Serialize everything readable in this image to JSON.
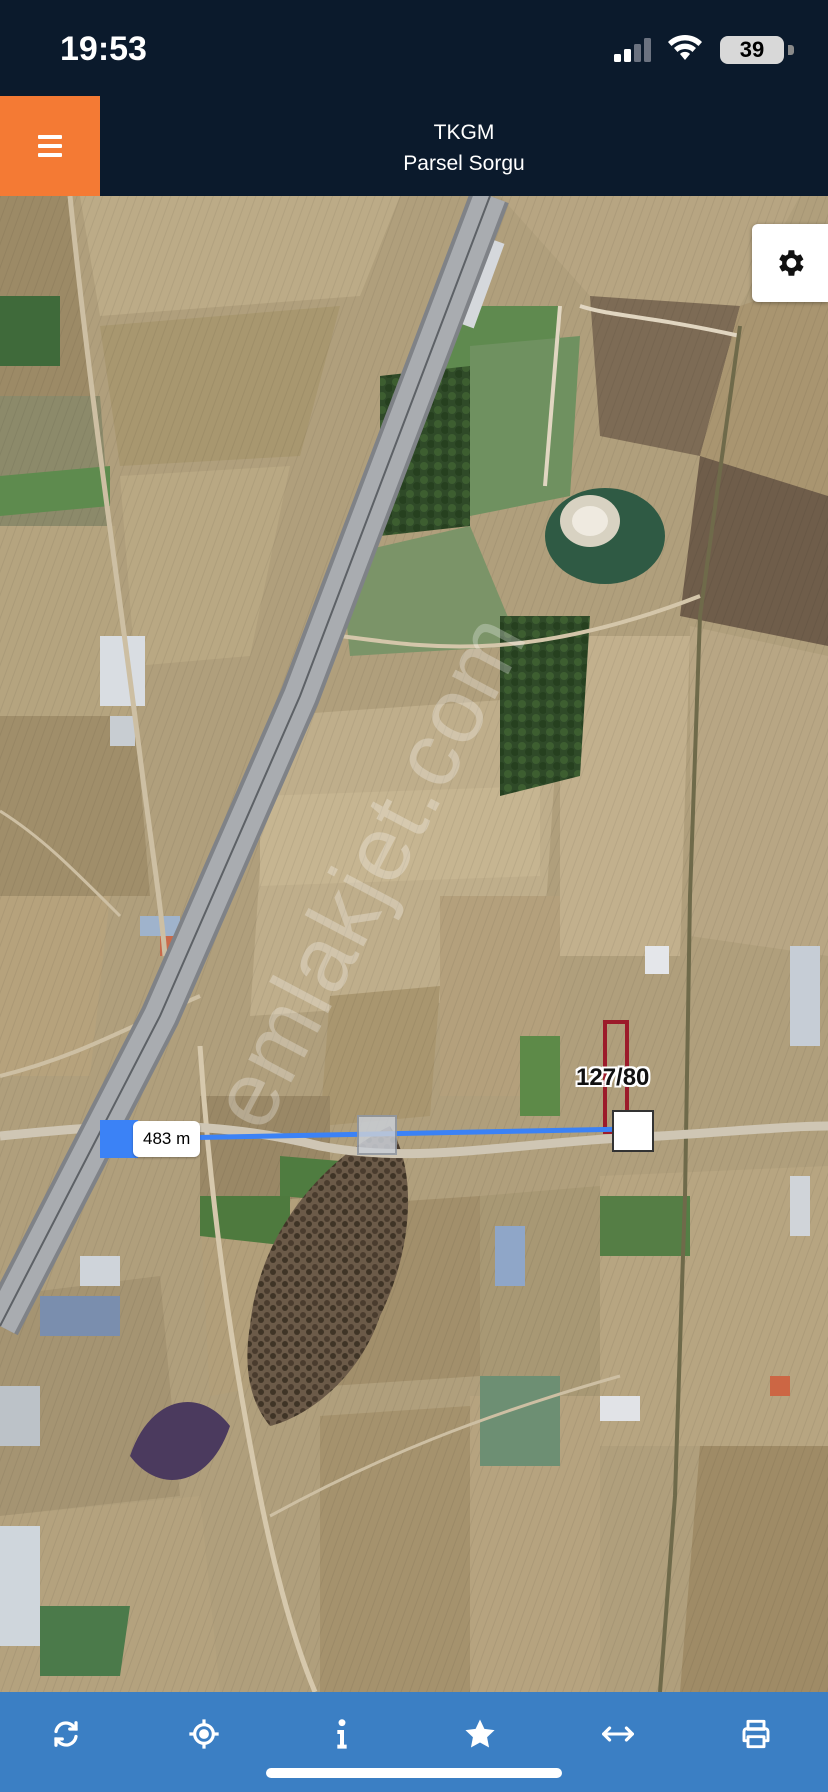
{
  "status_bar": {
    "time": "19:53",
    "battery": "39"
  },
  "header": {
    "title": "TKGM",
    "subtitle": "Parsel Sorgu",
    "accent_color": "#f47a34"
  },
  "map": {
    "parcel_label": "127/80",
    "distance_label": "483 m",
    "watermark": "emlakjet.com",
    "measure_line_color": "#3b82f6",
    "parcel_outline_color": "#9c1b2a"
  },
  "toolbar": {
    "icons": [
      "refresh-icon",
      "locate-icon",
      "info-icon",
      "star-icon",
      "measure-icon",
      "print-icon"
    ]
  }
}
